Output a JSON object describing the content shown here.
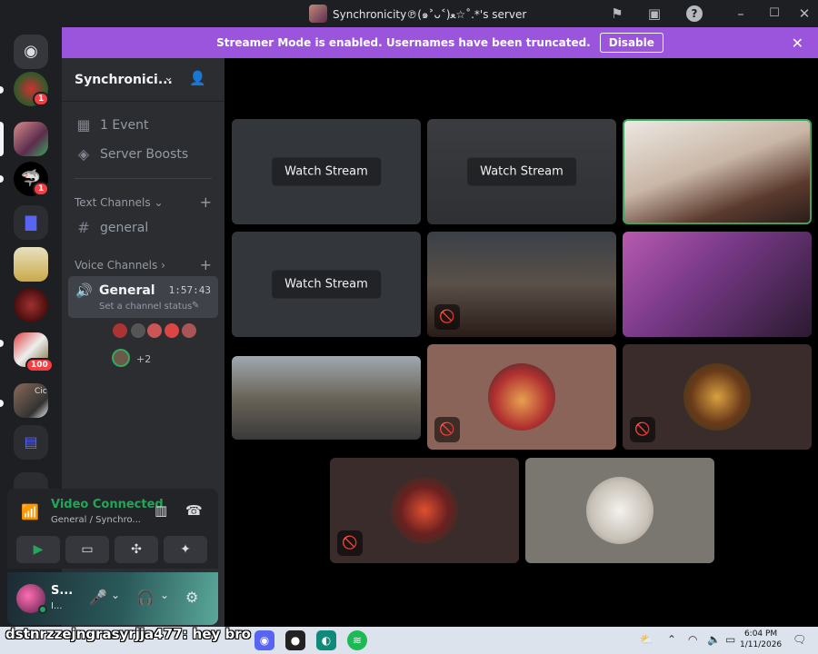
{
  "window": {
    "title": "Synchronicity℗(๑˃ᴗ˂)ﻌ☆˚.*'s server"
  },
  "banner": {
    "text": "Streamer Mode is enabled. Usernames have been truncated.",
    "button_label": "Disable"
  },
  "rail": {
    "badges": [
      "1",
      "1",
      "100"
    ],
    "folder_label": "Cic"
  },
  "sidebar": {
    "server_name": "Synchronici...",
    "event_label": "1 Event",
    "boosts_label": "Server Boosts",
    "text_category": "Text Channels",
    "text_channel": "general",
    "voice_category": "Voice Channels",
    "voice_channel": {
      "name": "General",
      "timer": "1:57:43",
      "status_placeholder": "Set a channel status",
      "extra_members": "+2"
    }
  },
  "voice_panel": {
    "status": "Video Connected",
    "location": "General / Synchro..."
  },
  "user_panel": {
    "name": "S...",
    "status": "I..."
  },
  "stage": {
    "watch_label": "Watch Stream"
  },
  "overlay": {
    "message": "dstnrzzejngrasyrjja477: hey bro"
  },
  "taskbar": {
    "time": "6:04 PM",
    "date": "1/11/2026"
  },
  "colors": {
    "banner": "#9b54dc",
    "connected": "#23a55a",
    "badge": "#f23f43",
    "speaking_border": "#3ba55d"
  }
}
